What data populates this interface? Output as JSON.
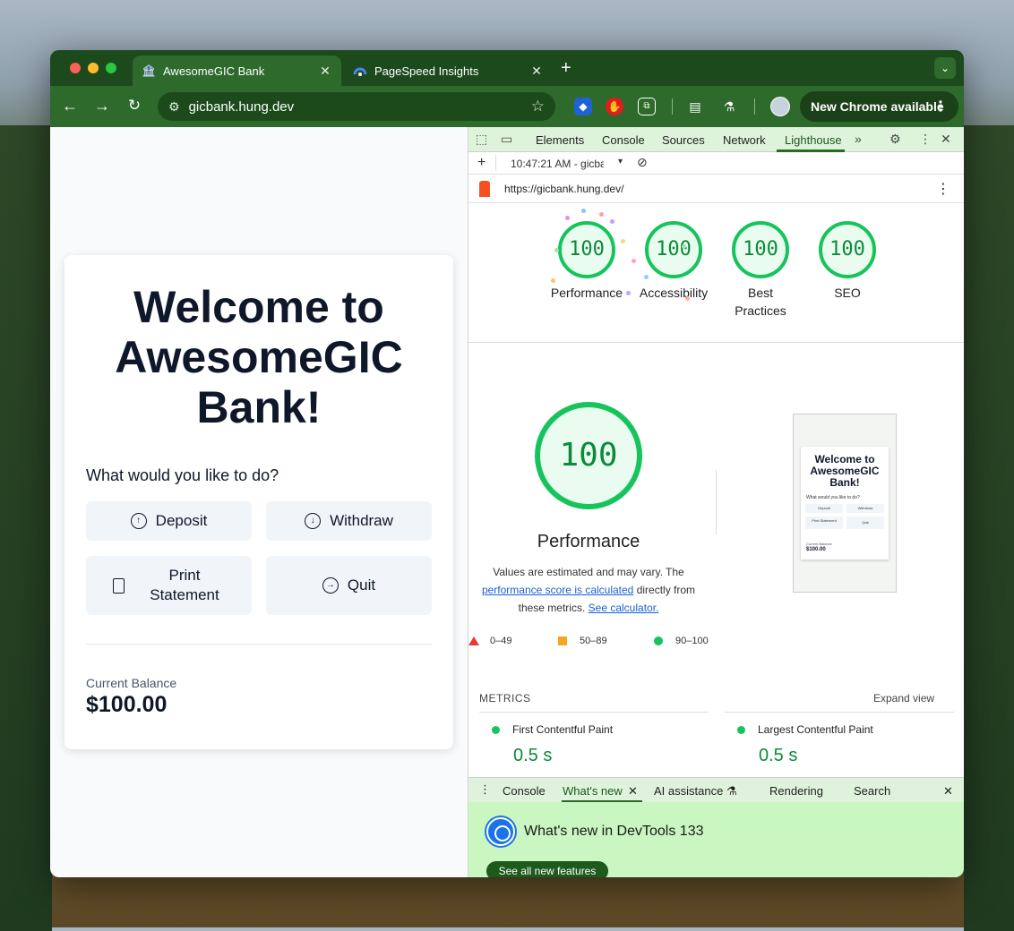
{
  "browser": {
    "tabs": [
      {
        "title": "AwesomeGIC Bank",
        "favicon": "bank-icon",
        "active": true
      },
      {
        "title": "PageSpeed Insights",
        "favicon": "pagespeed-icon",
        "active": false
      }
    ],
    "new_tab_symbol": "+",
    "url": "gicbank.hung.dev",
    "new_chrome_label": "New Chrome available",
    "colors": {
      "frame": "#1d4a1c",
      "toolbar": "#2d6a2b",
      "omnibox": "#1c4a1b"
    }
  },
  "app": {
    "title": "Welcome to AwesomeGIC Bank!",
    "prompt": "What would you like to do?",
    "buttons": {
      "deposit": "Deposit",
      "withdraw": "Withdraw",
      "print_statement": "Print Statement",
      "quit": "Quit"
    },
    "balance_label": "Current Balance",
    "balance_value": "$100.00"
  },
  "devtools": {
    "tabs": [
      "Elements",
      "Console",
      "Sources",
      "Network",
      "Lighthouse"
    ],
    "active_tab": "Lighthouse",
    "report_time": "10:47:21 AM - gicbar",
    "report_url": "https://gicbank.hung.dev/",
    "scores": [
      {
        "label": "Performance",
        "score": "100"
      },
      {
        "label": "Accessibility",
        "score": "100"
      },
      {
        "label": "Best Practices",
        "score": "100"
      },
      {
        "label": "SEO",
        "score": "100"
      }
    ],
    "performance": {
      "score": "100",
      "title": "Performance",
      "desc_1": "Values are estimated and may vary. The",
      "desc_link_1": "performance score is calculated",
      "desc_2": "directly from these metrics.",
      "desc_link_2": "See calculator."
    },
    "legend": [
      {
        "range": "0–49",
        "color": "#e53935"
      },
      {
        "range": "50–89",
        "color": "#f5a623"
      },
      {
        "range": "90–100",
        "color": "#16c45c"
      }
    ],
    "thumbnail": {
      "title": "Welcome to AwesomeGIC Bank!",
      "prompt": "What would you like to do?",
      "deposit": "Deposit",
      "withdraw": "Withdraw",
      "print": "Print Statement",
      "quit": "Quit",
      "balance_label": "Current Balance",
      "balance_value": "$100.00"
    },
    "metrics_label": "METRICS",
    "expand_label": "Expand view",
    "metrics": [
      {
        "name": "First Contentful Paint",
        "value": "0.5 s"
      },
      {
        "name": "Largest Contentful Paint",
        "value": "0.5 s"
      }
    ],
    "drawer_tabs": [
      "Console",
      "What's new",
      "AI assistance",
      "Rendering",
      "Search"
    ],
    "whats_new_title": "What's new in DevTools 133",
    "see_all": "See all new features",
    "colors": {
      "pass": "#16c45c",
      "pass_text": "#0b8a3a",
      "panel_bar": "#dff3dc"
    }
  }
}
